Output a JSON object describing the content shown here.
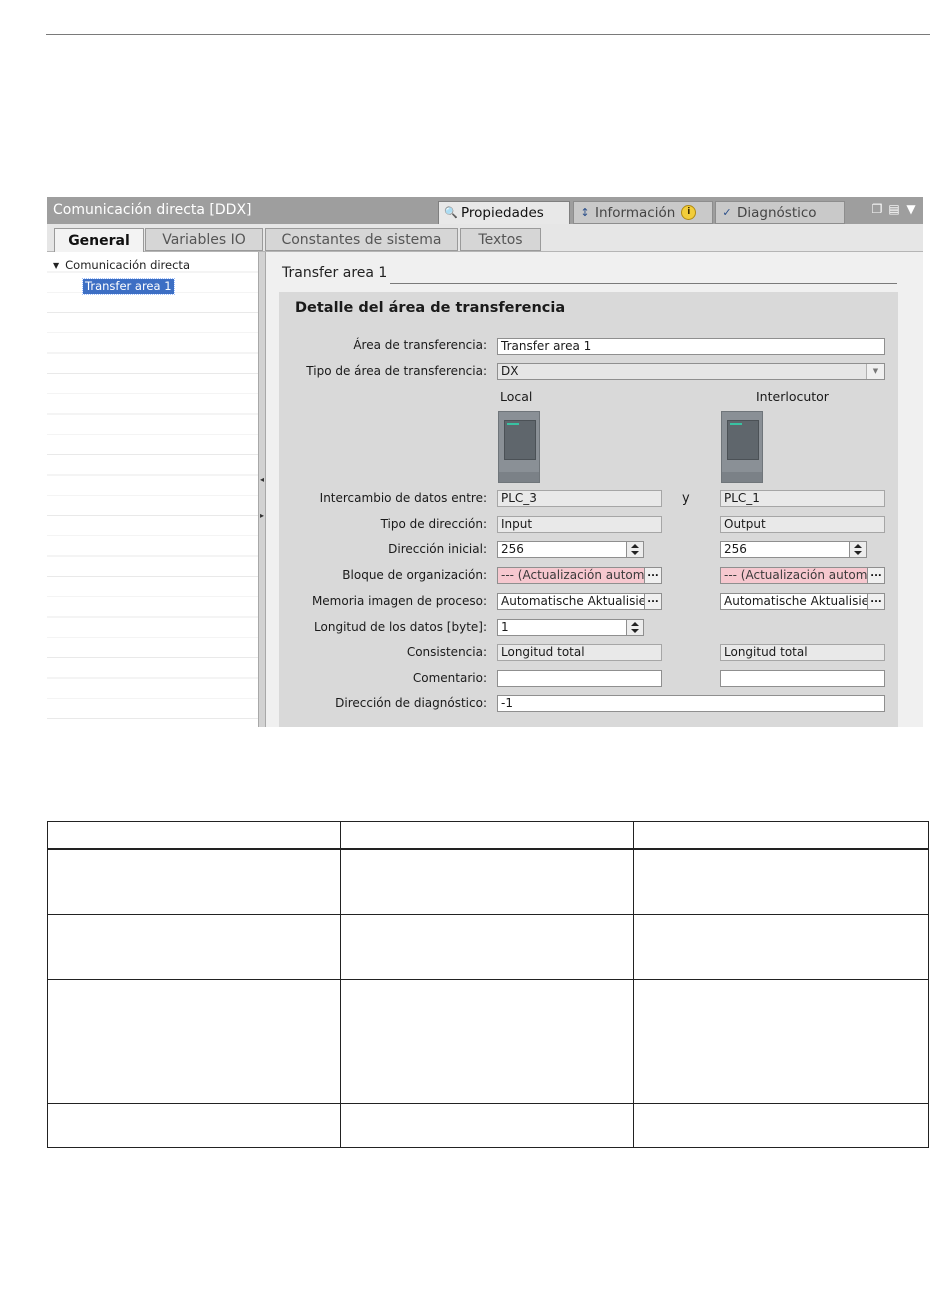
{
  "window": {
    "title": "Comunicación directa [DDX]",
    "title_tabs": [
      {
        "label": "Propiedades",
        "icon": "properties-icon",
        "active": true
      },
      {
        "label": "Información",
        "icon": "info-icon",
        "badge": "i"
      },
      {
        "label": "Diagnóstico",
        "icon": "diagnostics-icon"
      }
    ],
    "window_controls": [
      "restore-icon",
      "maximize-icon",
      "menu-arrow-icon"
    ]
  },
  "prop_tabs": [
    {
      "label": "General",
      "selected": true
    },
    {
      "label": "Variables IO"
    },
    {
      "label": "Constantes de sistema"
    },
    {
      "label": "Textos"
    }
  ],
  "tree": {
    "root": "Comunicación directa",
    "child": "Transfer area 1"
  },
  "content": {
    "section_title": "Transfer area 1",
    "panel_title": "Detalle del área de transferencia",
    "fields": {
      "area_label": "Área de transferencia:",
      "area_value": "Transfer area 1",
      "type_label": "Tipo de área de transferencia:",
      "type_value": "DX",
      "local_header": "Local",
      "partner_header": "Interlocutor",
      "exchange_label": "Intercambio de datos entre:",
      "exchange_local": "PLC_3",
      "exchange_and": "y",
      "exchange_partner": "PLC_1",
      "dirtype_label": "Tipo de dirección:",
      "dirtype_local": "Input",
      "dirtype_partner": "Output",
      "start_label": "Dirección inicial:",
      "start_local": "256",
      "start_partner": "256",
      "ob_label": "Bloque de organización:",
      "ob_local": "--- (Actualización automá",
      "ob_partner": "--- (Actualización automá",
      "pip_label": "Memoria imagen de proceso:",
      "pip_local": "Automatische Aktualisieri",
      "pip_partner": "Automatische Aktualisieri",
      "length_label": "Longitud de los datos [byte]:",
      "length_value": "1",
      "consistency_label": "Consistencia:",
      "consistency_local": "Longitud total",
      "consistency_partner": "Longitud total",
      "comment_label": "Comentario:",
      "comment_local": "",
      "comment_partner": "",
      "diag_label": "Dirección de diagnóstico:",
      "diag_value": "-1"
    }
  },
  "colors": {
    "titlebar": "#9e9e9e",
    "selection": "#3d6fc4",
    "error_field": "#f6c8cf"
  }
}
